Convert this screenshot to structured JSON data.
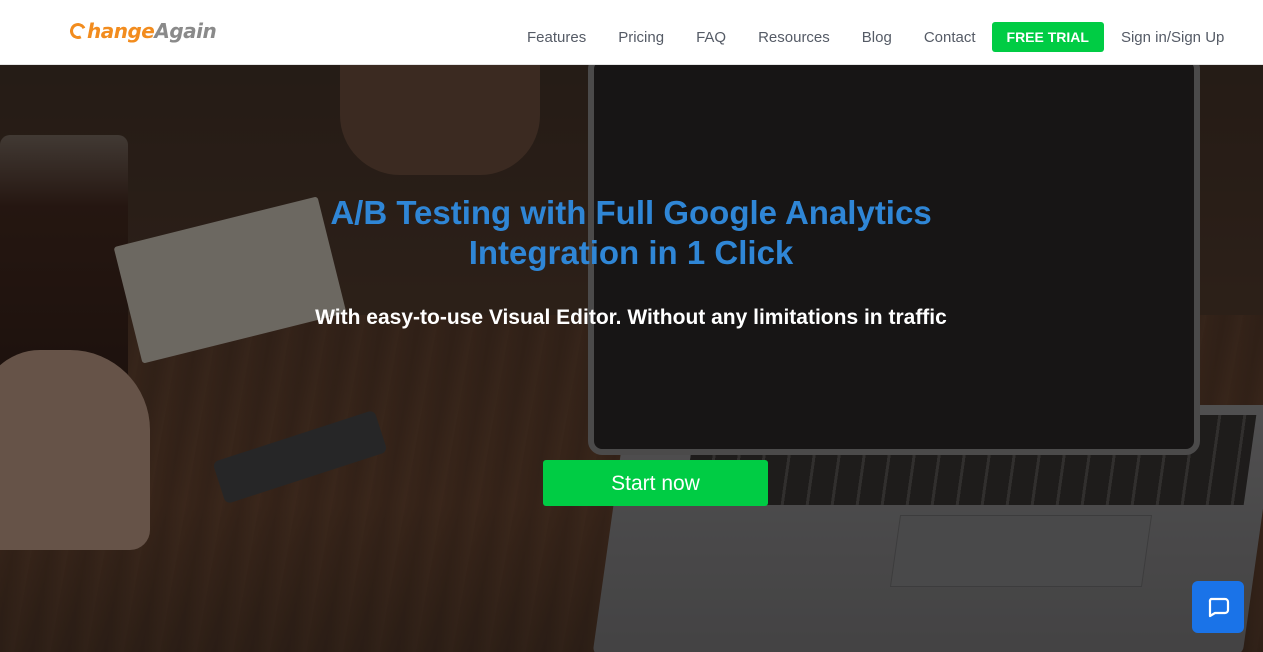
{
  "brand": {
    "logo_part1": "hange",
    "logo_part2": "Again",
    "accent_color": "#f28c1e",
    "secondary_color": "#8a8a8a"
  },
  "nav": {
    "items": [
      {
        "label": "Features"
      },
      {
        "label": "Pricing"
      },
      {
        "label": "FAQ"
      },
      {
        "label": "Resources"
      },
      {
        "label": "Blog"
      },
      {
        "label": "Contact"
      }
    ],
    "trial_label": "FREE TRIAL",
    "signin_label": "Sign in/Sign Up",
    "trial_color": "#00cc44"
  },
  "hero": {
    "title_line1": "A/B Testing with Full Google Analytics",
    "title_line2": "Integration in 1 Click",
    "subtitle": "With easy-to-use Visual Editor. Without any limitations in traffic",
    "cta_label": "Start now",
    "title_color": "#2f86d6",
    "cta_color": "#00cc44"
  },
  "chat": {
    "icon": "chat-bubble-icon",
    "color": "#1a73e8"
  }
}
